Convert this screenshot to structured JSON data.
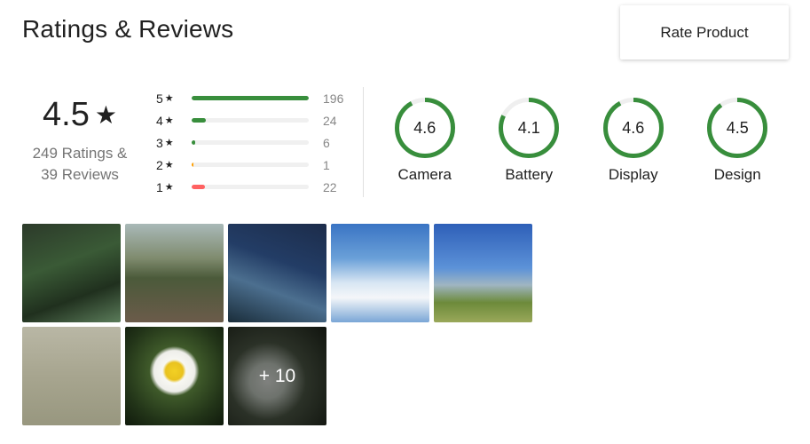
{
  "title": "Ratings & Reviews",
  "rate_button": "Rate Product",
  "overall": {
    "average": "4.5",
    "star_glyph": "★",
    "ratings_text": "249 Ratings &",
    "reviews_text": "39 Reviews"
  },
  "distribution": [
    {
      "stars": "5",
      "count": "196",
      "fraction": 1.0,
      "color": "#388e3c"
    },
    {
      "stars": "4",
      "count": "24",
      "fraction": 0.122,
      "color": "#388e3c"
    },
    {
      "stars": "3",
      "count": "6",
      "fraction": 0.031,
      "color": "#388e3c"
    },
    {
      "stars": "2",
      "count": "1",
      "fraction": 0.005,
      "color": "#ff9f00"
    },
    {
      "stars": "1",
      "count": "22",
      "fraction": 0.112,
      "color": "#ff6161"
    }
  ],
  "aspects": [
    {
      "name": "Camera",
      "score": "4.6",
      "fraction": 0.92
    },
    {
      "name": "Battery",
      "score": "4.1",
      "fraction": 0.82
    },
    {
      "name": "Display",
      "score": "4.6",
      "fraction": 0.92
    },
    {
      "name": "Design",
      "score": "4.5",
      "fraction": 0.9
    }
  ],
  "ring_color": "#388e3c",
  "gallery": {
    "more_label": "+ 10"
  }
}
